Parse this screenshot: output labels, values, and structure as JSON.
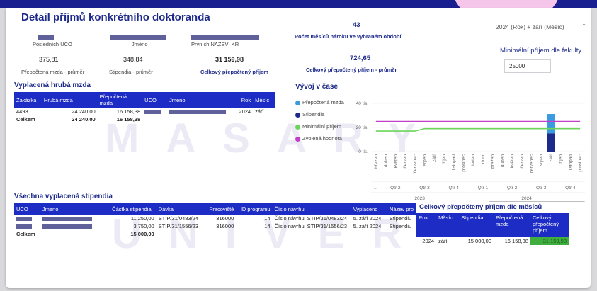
{
  "page": {
    "title": "Detail příjmů konkrétního doktoranda"
  },
  "identity": {
    "uco_label": "Posledních UCO",
    "jmeno_label": "Jméno",
    "prvnich_label": "Prvních NAZEV_KR"
  },
  "kpis": {
    "mzda_value": "375,81",
    "mzda_label": "Přepočtená mzda - průměr",
    "stipendia_value": "348,84",
    "stipendia_label": "Stipendia - průměr",
    "celkem_value": "31 159,98",
    "celkem_label": "Celkový přepočtený příjem",
    "mesice_value": "43",
    "mesice_label": "Počet měsíců nároku ve vybraném období",
    "prumer_value": "724,65",
    "prumer_label": "Celkový přepočtený příjem - průměr"
  },
  "filters": {
    "period_value": "2024 (Rok) + září (Měsíc)",
    "min_label": "Minimální příjem dle fakulty",
    "min_value": "25000"
  },
  "wages": {
    "title": "Vyplacená hrubá mzda",
    "headers": [
      "Zakázka",
      "Hrubá mzda",
      "Přepočtená mzda",
      "UCO",
      "Jmeno",
      "Rok",
      "Měsíc"
    ],
    "row": {
      "zakazka": "4493",
      "hruba": "24 240,00",
      "prepoctena": "16 158,38",
      "rok": "2024",
      "mesic": "září"
    },
    "total": {
      "label": "Celkem",
      "hruba": "24 240,00",
      "prepoctena": "16 158,38"
    }
  },
  "chart": {
    "title": "Vývoj v čase",
    "legend": [
      {
        "label": "Přepočtená mzda",
        "color": "#3b9be0"
      },
      {
        "label": "Stipendia",
        "color": "#1d2a8a"
      },
      {
        "label": "Minimální příjem",
        "color": "#6cd65a"
      },
      {
        "label": "Zvolená hodnota",
        "color": "#c43fc8"
      }
    ]
  },
  "chart_data": {
    "type": "line",
    "x": [
      "březen",
      "duben",
      "květen",
      "červen",
      "červenec",
      "srpen",
      "září",
      "říjen",
      "listopad",
      "prosinec",
      "leden",
      "únor",
      "březen",
      "duben",
      "květen",
      "červen",
      "červenec",
      "srpen",
      "září",
      "říjen",
      "listopad",
      "prosinec"
    ],
    "quarters": [
      "...",
      "Qtr 2",
      "Qtr 3",
      "Qtr 4",
      "Qtr 1",
      "Qtr 2",
      "Qtr 3",
      "Qtr 4"
    ],
    "years": [
      "2023",
      "2024"
    ],
    "ytick_labels": [
      "40 tis.",
      "20 tis.",
      "0 tis."
    ],
    "ylim": [
      0,
      40000
    ],
    "series": [
      {
        "name": "Minimální příjem",
        "values": [
          17000,
          17000,
          17000,
          17000,
          17000,
          19000,
          19000,
          19000,
          19000,
          19000,
          19000,
          19000,
          19000,
          19000,
          19000,
          19000,
          19000,
          19000,
          19000,
          19000,
          19000,
          19000
        ]
      },
      {
        "name": "Zvolená hodnota",
        "values": [
          25000,
          25000,
          25000,
          25000,
          25000,
          25000,
          25000,
          25000,
          25000,
          25000,
          25000,
          25000,
          25000,
          25000,
          25000,
          25000,
          25000,
          25000,
          25000,
          25000,
          25000,
          25000
        ]
      }
    ],
    "bar": {
      "category": "září",
      "index": 18,
      "stipendia": 15000,
      "prepoctena_mzda": 16158.38
    }
  },
  "stipends": {
    "title": "Všechna vyplacená stipendia",
    "headers": [
      "UCO",
      "Jmeno",
      "Částka stipendia",
      "Dávka",
      "Pracoviště",
      "ID programu",
      "Číslo návrhu",
      "Vyplaceno",
      "Název pro"
    ],
    "rows": [
      {
        "castka": "11 250,00",
        "davka": "STIP/31/0483/24",
        "prac": "316000",
        "id": "14",
        "navrh": "Číslo návrhu: STIP/31/0483/24",
        "vypl": "5. září 2024",
        "nazev": "Stipendiu"
      },
      {
        "castka": "3 750,00",
        "davka": "STIP/31/1556/23",
        "prac": "316000",
        "id": "14",
        "navrh": "Číslo návrhu: STIP/31/1556/23",
        "vypl": "5. září 2024",
        "nazev": "Stipendiu"
      }
    ],
    "total": {
      "label": "Celkem",
      "castka": "15 000,00"
    }
  },
  "monthly": {
    "title": "Celkový přepočtený příjem dle měsíců",
    "headers": [
      "Rok",
      "Měsíc",
      "Stipendia",
      "Přepočtená mzda",
      "Celkový přepočtený příjem"
    ],
    "row": {
      "rok": "2024",
      "mesic": "září",
      "stip": "15 000,00",
      "mzda": "16 158,38",
      "celkem": "31 159,98"
    },
    "highlight": "#3fae3f"
  },
  "watermark": {
    "line1": "MASARY",
    "line2": "UNIVERZ"
  }
}
